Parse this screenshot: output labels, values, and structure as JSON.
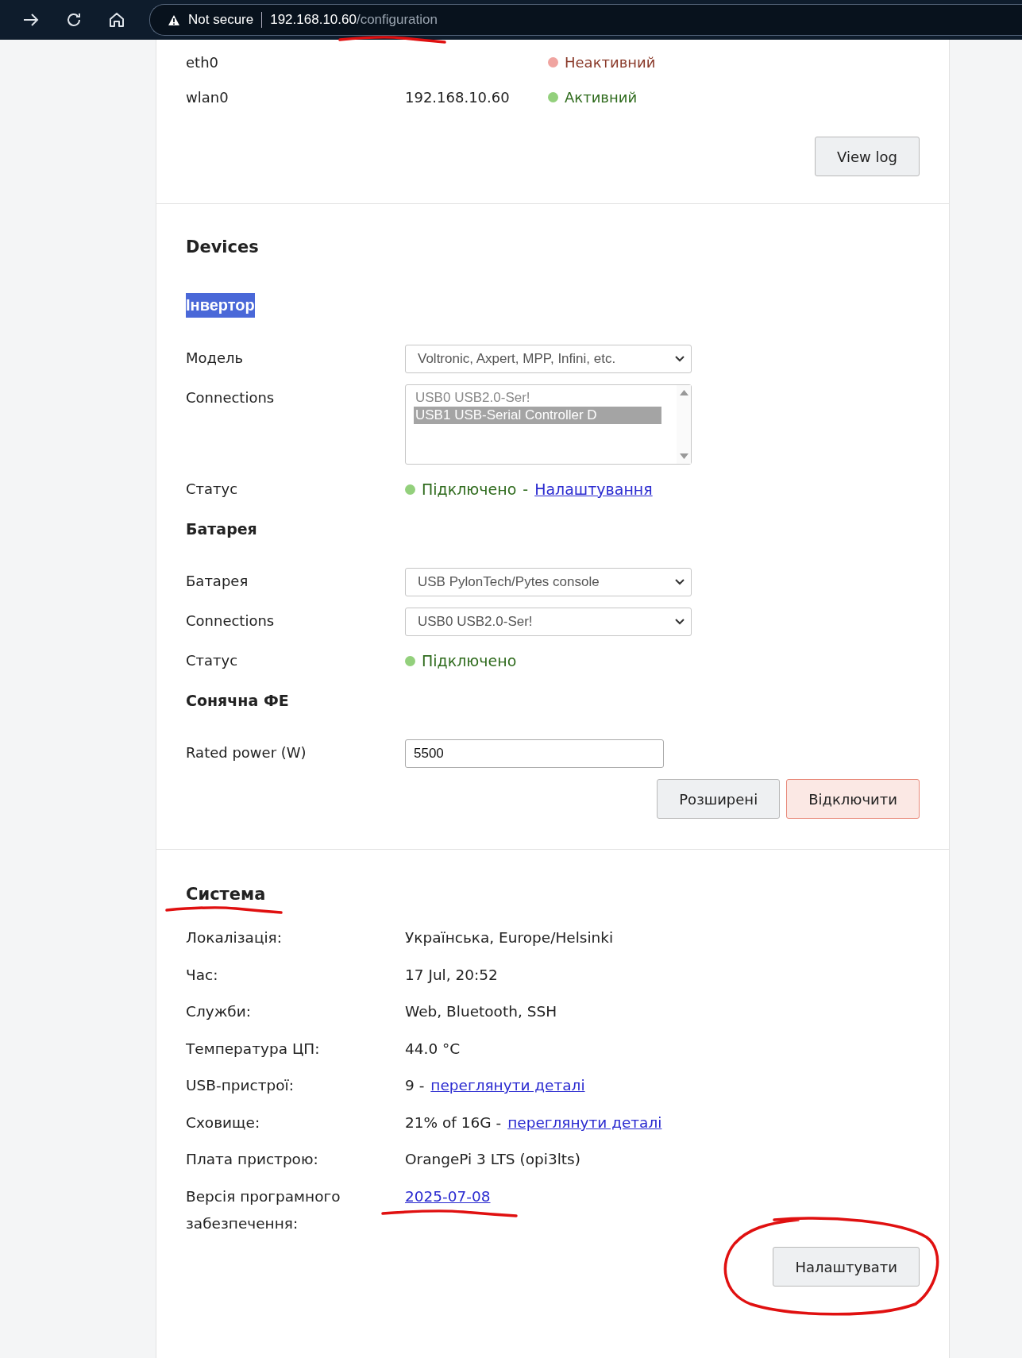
{
  "browser": {
    "security": "Not secure",
    "url_host": "192.168.10.60",
    "url_path": "/configuration",
    "marked": true
  },
  "network": {
    "interfaces": [
      {
        "name": "eth0",
        "status": "Неактивний",
        "active": false
      },
      {
        "name": "wlan0",
        "address": "192.168.10.60",
        "status": "Активний",
        "active": true
      }
    ],
    "button": "View log"
  },
  "devices": {
    "title": "Devices",
    "sections": [
      {
        "title": "Інвертор",
        "highlighted": true,
        "rows": [
          {
            "kind": "select",
            "label": "Модель",
            "value": "Voltronic, Axpert, MPP, Infini, etc."
          },
          {
            "kind": "listbox",
            "label": "Connections",
            "options": [
              {
                "label": "USB0 USB2.0-Ser!",
                "selected": false
              },
              {
                "label": "USB1 USB-Serial Controller D",
                "selected": true
              }
            ]
          },
          {
            "kind": "status",
            "label": "Статус",
            "connected": true,
            "text": "Підключено",
            "separator": "-",
            "link": "Налаштування"
          }
        ]
      },
      {
        "title": "Батарея",
        "highlighted": false,
        "rows": [
          {
            "kind": "select",
            "label": "Батарея",
            "value": "USB PylonTech/Pytes console"
          },
          {
            "kind": "select",
            "label": "Connections",
            "value": "USB0 USB2.0-Ser!"
          },
          {
            "kind": "status",
            "label": "Статус",
            "connected": true,
            "text": "Підключено"
          }
        ]
      },
      {
        "title": "Сонячна ФЕ",
        "highlighted": false,
        "rows": [
          {
            "kind": "input",
            "label": "Rated power (W)",
            "value": "5500"
          }
        ]
      }
    ],
    "buttons": [
      {
        "label": "Розширені",
        "kind": "default"
      },
      {
        "label": "Відключити",
        "kind": "danger"
      }
    ]
  },
  "system": {
    "title": "Система",
    "marked": true,
    "rows": [
      {
        "label": "Локалізація:",
        "value": "Українська, Europe/Helsinki"
      },
      {
        "label": "Час:",
        "value": "17 Jul, 20:52"
      },
      {
        "label": "Служби:",
        "value": "Web, Bluetooth, SSH"
      },
      {
        "label": "Температура ЦП:",
        "value": "44.0 °C"
      },
      {
        "label": "USB-пристрої:",
        "value": "9 -",
        "link": "переглянути деталі"
      },
      {
        "label": "Сховище:",
        "value": "21% of 16G -",
        "link": "переглянути деталі"
      },
      {
        "label": "Плата пристрою:",
        "value": "OrangePi 3 LTS (opi3lts)"
      },
      {
        "label": "Версія програмного забезпечення:",
        "link": "2025-07-08",
        "marked": true
      }
    ],
    "button": {
      "label": "Налаштувати",
      "marked": true
    }
  }
}
